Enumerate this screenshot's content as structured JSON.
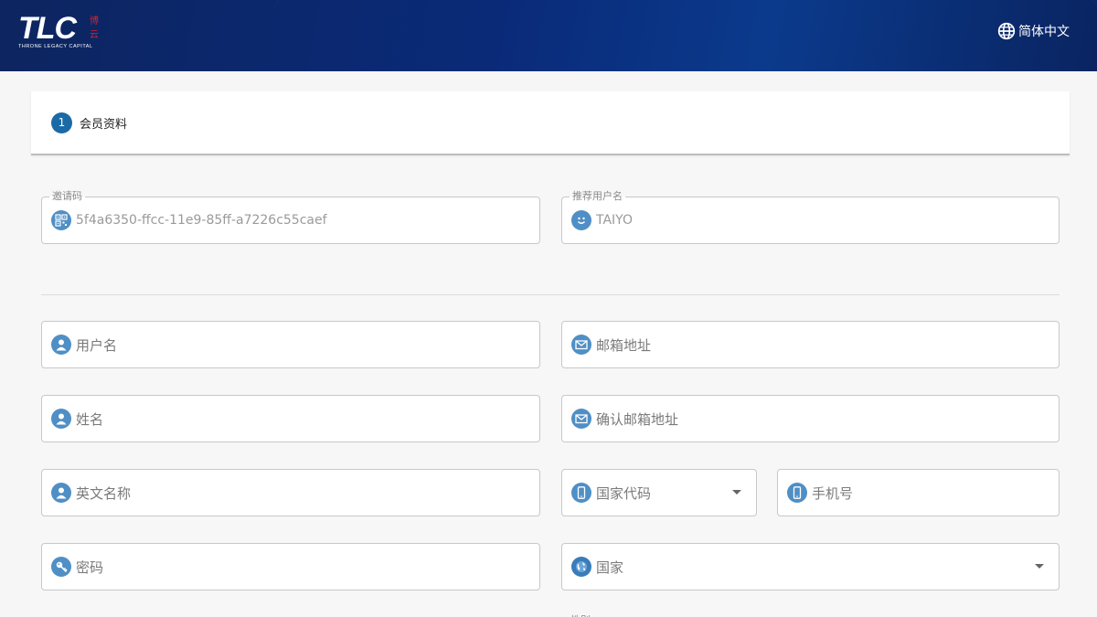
{
  "header": {
    "logo_text": "TLC",
    "logo_seal": "博云",
    "logo_subtitle": "THRONE LEGACY CAPITAL",
    "language_label": "简体中文",
    "colors": {
      "bar": "#0a2a78",
      "seal": "#d2232a"
    }
  },
  "stepper": {
    "step_number": "1",
    "step_label": "会员资料"
  },
  "form": {
    "invite_code": {
      "label": "邀请码",
      "value": "5f4a6350-ffcc-11e9-85ff-a7226c55caef",
      "icon": "qr-code-icon"
    },
    "referrer": {
      "label": "推荐用户名",
      "value": "TAIYO",
      "icon": "smiley-icon"
    },
    "username": {
      "placeholder": "用户名",
      "icon": "user-icon"
    },
    "email": {
      "placeholder": "邮箱地址",
      "icon": "mail-icon"
    },
    "name": {
      "placeholder": "姓名",
      "icon": "user-icon"
    },
    "confirm_email": {
      "placeholder": "确认邮箱地址",
      "icon": "mail-icon"
    },
    "english_name": {
      "placeholder": "英文名称",
      "icon": "user-icon"
    },
    "country_code": {
      "placeholder": "国家代码",
      "icon": "mobile-icon"
    },
    "phone": {
      "placeholder": "手机号",
      "icon": "mobile-icon"
    },
    "password": {
      "placeholder": "密码",
      "icon": "key-icon"
    },
    "country": {
      "placeholder": "国家",
      "icon": "globe-icon"
    },
    "gender_label": "性别"
  },
  "accent_color": "#4f8fc5"
}
